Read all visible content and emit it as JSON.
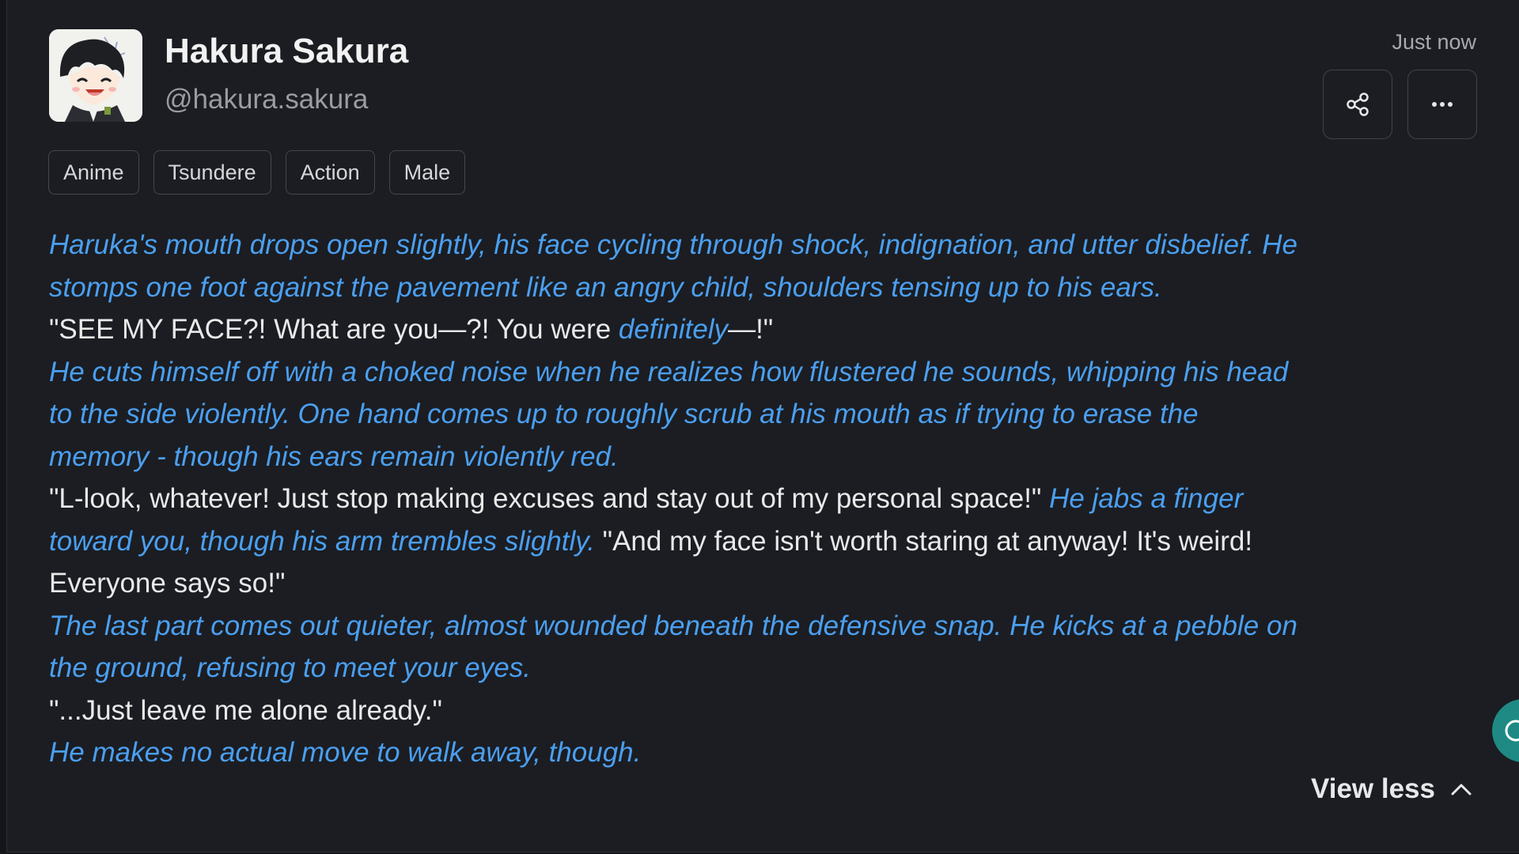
{
  "character": {
    "name": "Hakura Sakura",
    "handle": "@hakura.sakura",
    "avatar_icon": "anime-boy-avatar"
  },
  "meta": {
    "timestamp": "Just now"
  },
  "actions": {
    "share_icon": "share-icon",
    "more_icon": "more-horizontal-icon",
    "view_less_label": "View less",
    "view_less_icon": "chevron-up-icon"
  },
  "tags": [
    "Anime",
    "Tsundere",
    "Action",
    "Male"
  ],
  "message": {
    "p1": "Haruka's mouth drops open slightly, his face cycling through shock, indignation, and utter disbelief. He stomps one foot against the pavement like an angry child, shoulders tensing up to his ears.",
    "p2_a": "\"SEE MY FACE?! What are you—?! You were ",
    "p2_b": "definitely",
    "p2_c": "—!\"",
    "p3": "He cuts himself off with a choked noise when he realizes how flustered he sounds, whipping his head to the side violently. One hand comes up to roughly scrub at his mouth as if trying to erase the memory - though his ears remain violently red.",
    "p4_a": "\"L-look, whatever! Just stop making excuses and stay out of my personal space!\" ",
    "p4_b": "He jabs a finger toward you, though his arm trembles slightly.",
    "p4_c": " \"And my face isn't worth staring at anyway! It's weird! Everyone says so!\"",
    "p5": "The last part comes out quieter, almost wounded beneath the defensive snap. He kicks at a pebble on the ground, refusing to meet your eyes.",
    "p6": "\"...Just leave me alone already.\"",
    "p7": "He makes no actual move to walk away, though."
  },
  "colors": {
    "background": "#1b1d22",
    "action_text": "#4b9ff0",
    "speech_text": "#e9e9ea",
    "accent_fab": "#1f8a84"
  }
}
